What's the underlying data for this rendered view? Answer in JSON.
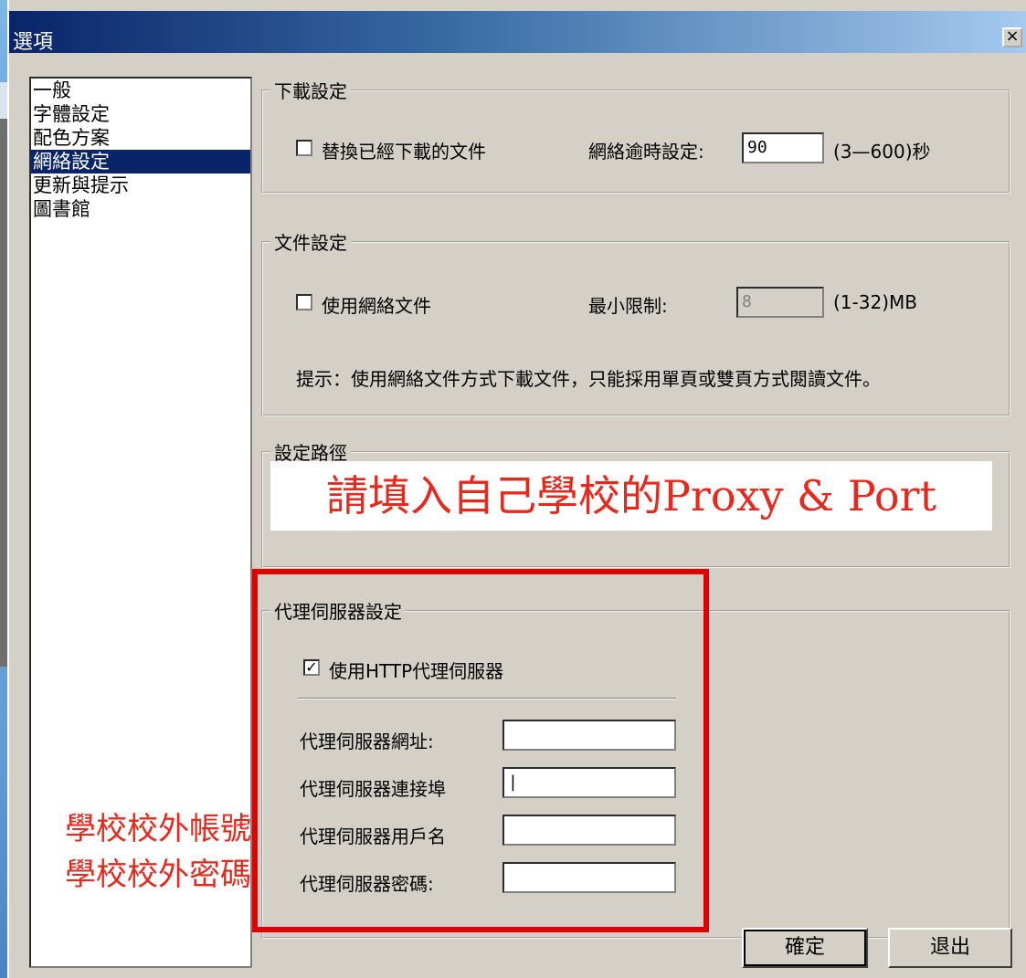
{
  "window": {
    "title": "選項",
    "close_label": "×"
  },
  "nav": {
    "items": [
      "一般",
      "字體設定",
      "配色方案",
      "網絡設定",
      "更新與提示",
      "圖書館"
    ],
    "selected": "網絡設定"
  },
  "download": {
    "group_label": "下載設定",
    "replace_label": "替換已經下載的文件",
    "replace_checked": false,
    "timeout_label": "網絡逾時設定:",
    "timeout_value": "90",
    "timeout_range": "(3—600)秒"
  },
  "file": {
    "group_label": "文件設定",
    "use_network_label": "使用網絡文件",
    "use_network_checked": false,
    "min_limit_label": "最小限制:",
    "min_limit_value": "8",
    "min_limit_range": "(1-32)MB",
    "hint": "提示：使用網絡文件方式下載文件，只能採用單頁或雙頁方式閱讀文件。"
  },
  "path": {
    "group_label": "設定路徑"
  },
  "proxy": {
    "group_label": "代理伺服器設定",
    "use_http_label": "使用HTTP代理伺服器",
    "use_http_checked": true,
    "address_label": "代理伺服器網址:",
    "address_value": "",
    "port_label": "代理伺服器連接埠",
    "port_value": "|",
    "user_label": "代理伺服器用戶名",
    "user_value": "",
    "password_label": "代理伺服器密碼:",
    "password_value": ""
  },
  "annotations": {
    "banner": "請填入自己學校的Proxy & Port",
    "account_note": "學校校外帳號",
    "password_note": "學校校外密碼",
    "color": "#e8281c"
  },
  "buttons": {
    "ok": "確定",
    "exit": "退出"
  }
}
